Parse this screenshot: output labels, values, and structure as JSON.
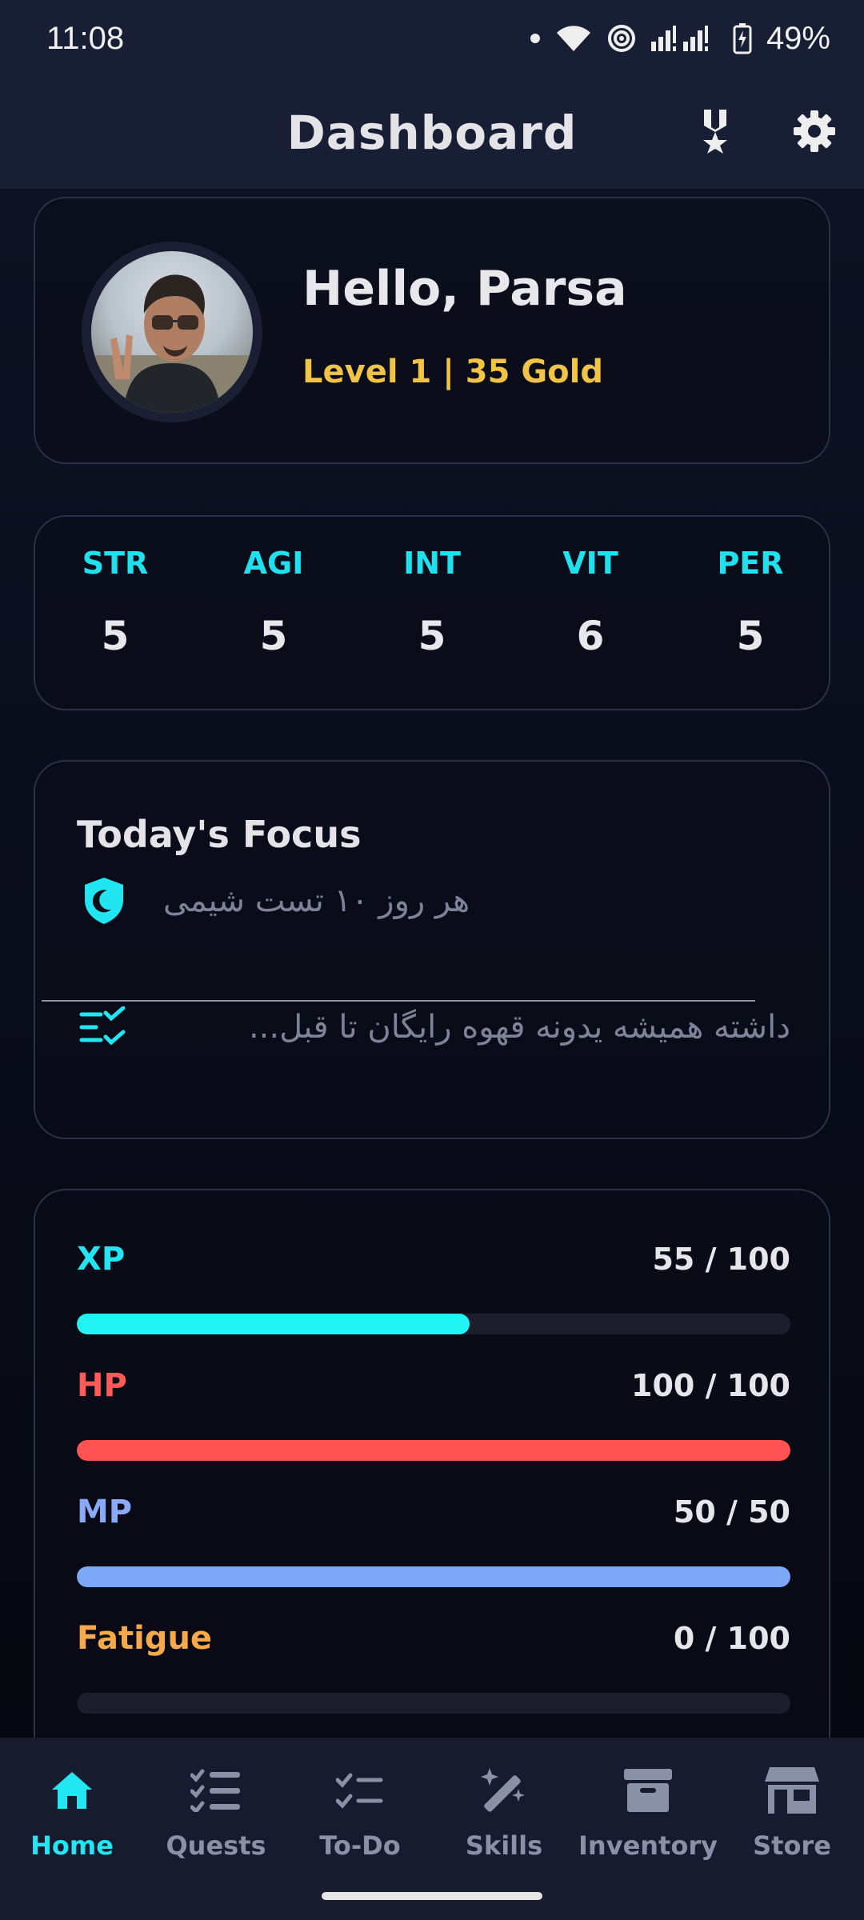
{
  "status_bar": {
    "time": "11:08",
    "battery": "49%"
  },
  "app_bar": {
    "title": "Dashboard",
    "icons": [
      "medal-icon",
      "gear-icon"
    ]
  },
  "profile": {
    "greeting": "Hello, Parsa",
    "level_line": "Level 1 | 35 Gold"
  },
  "stats": [
    {
      "label": "STR",
      "value": "5"
    },
    {
      "label": "AGI",
      "value": "5"
    },
    {
      "label": "INT",
      "value": "5"
    },
    {
      "label": "VIT",
      "value": "6"
    },
    {
      "label": "PER",
      "value": "5"
    }
  ],
  "focus": {
    "title": "Today's Focus",
    "items": [
      {
        "icon": "shield-moon-icon",
        "text": "هر روز ۱۰ تست شیمی"
      },
      {
        "icon": "checklist-icon",
        "text": "داشته همیشه یدونه قهوه رایگان تا قبل..."
      }
    ]
  },
  "bars": [
    {
      "label": "XP",
      "value_text": "55 / 100",
      "fraction": 0.55,
      "color": "#21f2f2",
      "label_color": "#21e6f2"
    },
    {
      "label": "HP",
      "value_text": "100 / 100",
      "fraction": 1.0,
      "color": "#ff5252",
      "label_color": "#ff5a5a"
    },
    {
      "label": "MP",
      "value_text": "50 / 50",
      "fraction": 1.0,
      "color": "#7da7f7",
      "label_color": "#8aaaf5"
    },
    {
      "label": "Fatigue",
      "value_text": "0 / 100",
      "fraction": 0.0,
      "color": "#f7a94a",
      "label_color": "#f5a94a"
    }
  ],
  "nav": {
    "active": "Home",
    "items": [
      {
        "label": "Home",
        "icon": "home-icon"
      },
      {
        "label": "Quests",
        "icon": "quest-list-icon"
      },
      {
        "label": "To-Do",
        "icon": "todo-check-icon"
      },
      {
        "label": "Skills",
        "icon": "magic-wand-icon"
      },
      {
        "label": "Inventory",
        "icon": "archive-box-icon"
      },
      {
        "label": "Store",
        "icon": "storefront-icon"
      }
    ]
  },
  "colors": {
    "accent": "#22e6f2",
    "gold": "#f2c445",
    "background": "#0a0d1c"
  }
}
